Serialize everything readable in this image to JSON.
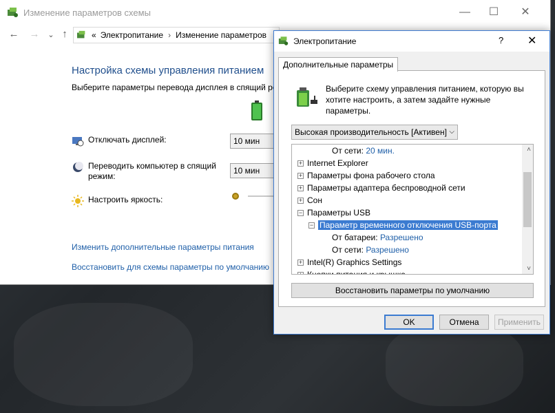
{
  "main_window": {
    "title": "Изменение параметров схемы",
    "controls": {
      "minimize": "—",
      "maximize": "☐",
      "close": "✕"
    },
    "nav": {
      "back": "←",
      "forward": "→",
      "recent": "⌄",
      "up": "↑"
    },
    "breadcrumb": {
      "prefix": "«",
      "items": [
        "Электропитание",
        "Изменение параметров"
      ],
      "separator": "›"
    },
    "heading": "Настройка схемы управления питанием",
    "subtext": "Выберите параметры перевода дисплея в спящий ре",
    "settings": [
      {
        "label": "Отключать дисплей:",
        "value": "10 мин",
        "icon": "monitor-clock-icon"
      },
      {
        "label": "Переводить компьютер в спящий режим:",
        "value": "10 мин",
        "icon": "sleep-moon-icon"
      },
      {
        "label": "Настроить яркость:",
        "icon": "sun-brightness-icon",
        "brightness_level": 0.0
      }
    ],
    "links": [
      "Изменить дополнительные параметры питания",
      "Восстановить для схемы параметры по умолчанию"
    ]
  },
  "dialog": {
    "title": "Электропитание",
    "help": "?",
    "close": "✕",
    "tab": "Дополнительные параметры",
    "intro": "Выберите схему управления питанием, которую вы хотите настроить, а затем задайте нужные параметры.",
    "plan": "Высокая производительность [Активен]",
    "tree": [
      {
        "indent": 2,
        "label": "От сети:",
        "value": "20 мин.",
        "expander": ""
      },
      {
        "indent": 0,
        "label": "Internet Explorer",
        "expander": "+"
      },
      {
        "indent": 0,
        "label": "Параметры фона рабочего стола",
        "expander": "+"
      },
      {
        "indent": 0,
        "label": "Параметры адаптера беспроводной сети",
        "expander": "+"
      },
      {
        "indent": 0,
        "label": "Сон",
        "expander": "+"
      },
      {
        "indent": 0,
        "label": "Параметры USB",
        "expander": "−"
      },
      {
        "indent": 1,
        "label": "Параметр временного отключения USB-порта",
        "expander": "−",
        "selected": true
      },
      {
        "indent": 2,
        "label": "От батареи:",
        "value": "Разрешено",
        "expander": ""
      },
      {
        "indent": 2,
        "label": "От сети:",
        "value": "Разрешено",
        "expander": ""
      },
      {
        "indent": 0,
        "label": "Intel(R) Graphics Settings",
        "expander": "+"
      },
      {
        "indent": 0,
        "label": "Кнопки питания и крышка",
        "expander": "+"
      }
    ],
    "restore_label": "Восстановить параметры по умолчанию",
    "buttons": {
      "ok": "OK",
      "cancel": "Отмена",
      "apply": "Применить"
    }
  },
  "colors": {
    "accent": "#3b7bd1",
    "link": "#1f5fa8",
    "heading": "#1f4e8c"
  }
}
